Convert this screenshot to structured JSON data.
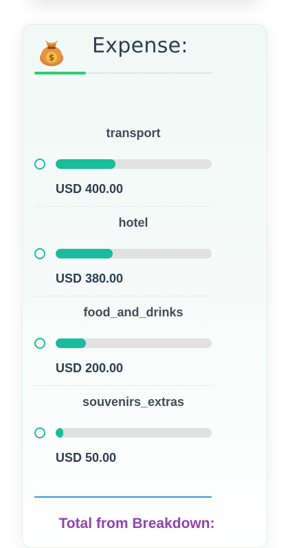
{
  "expense": {
    "icon": "money-bag-icon",
    "title": "Expense:",
    "items": [
      {
        "label": "transport",
        "amount": "USD 400.00",
        "share": 0.385
      },
      {
        "label": "hotel",
        "amount": "USD 380.00",
        "share": 0.365
      },
      {
        "label": "food_and_drinks",
        "amount": "USD 200.00",
        "share": 0.192
      },
      {
        "label": "souvenirs_extras",
        "amount": "USD 50.00",
        "share": 0.048
      }
    ],
    "total_label": "Total from Breakdown:"
  },
  "colors": {
    "accent": "#1abc9c",
    "header_accent": "#2ecc71",
    "title": "#2c3e50",
    "total_rule": "#3498db",
    "total_label": "#8e44ad"
  }
}
